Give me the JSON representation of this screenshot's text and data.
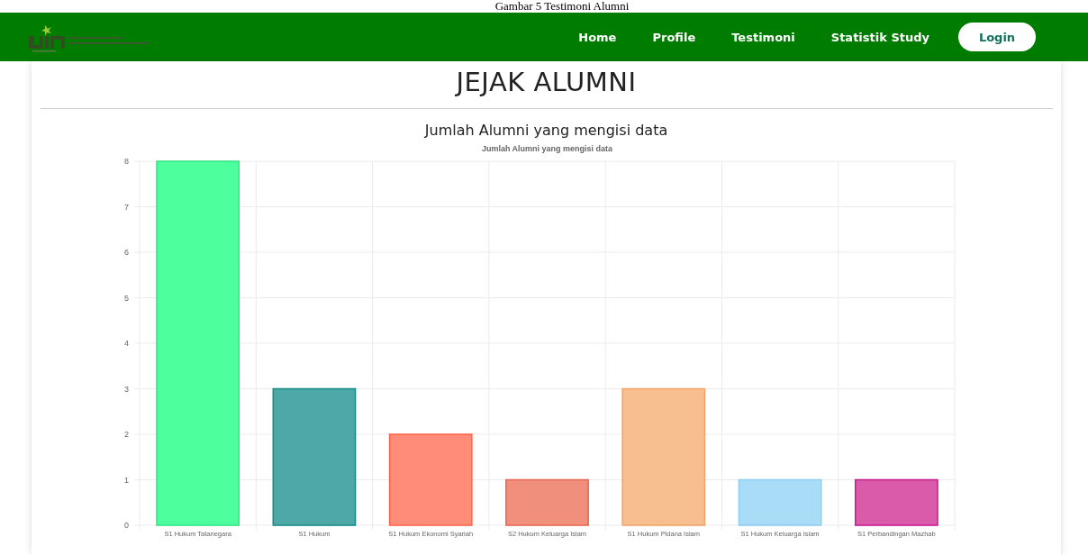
{
  "caption": "Gambar 5 Testimoni Alumni",
  "nav": {
    "items": [
      {
        "label": "Home"
      },
      {
        "label": "Profile"
      },
      {
        "label": "Testimoni"
      },
      {
        "label": "Statistik Study"
      }
    ],
    "login": "Login"
  },
  "page_title": "JEJAK ALUMNI",
  "section_title": "Jumlah Alumni yang mengisi data",
  "chart_data": {
    "type": "bar",
    "title": "Jumlah Alumni yang mengisi data",
    "categories": [
      "S1 Hukum Tatanegara",
      "S1 Hukum",
      "S1 Hukum Ekonomi Syariah",
      "S2 Hukum Keluarga Islam",
      "S1 Hukum Pidana Islam",
      "S1 Hukum Keluarga Islam",
      "S1 Perbandingan Mazhab"
    ],
    "series": [
      {
        "colors": [
          "#4dff9d",
          "#4ea8a7",
          "#ff8c78",
          "#f08f7c",
          "#f7be8f",
          "#a9dcf7",
          "#d95ba9"
        ],
        "values": [
          8,
          3,
          2,
          1,
          3,
          1,
          1
        ]
      }
    ],
    "ylim": [
      0,
      8
    ],
    "grid": true,
    "yticks": [
      0,
      1,
      2,
      3,
      4,
      5,
      6,
      7,
      8
    ]
  }
}
